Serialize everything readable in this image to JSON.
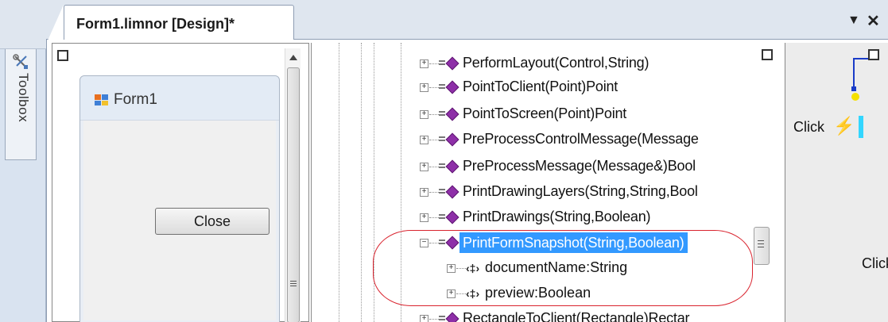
{
  "tab": {
    "title": "Form1.limnor [Design]*",
    "dropdown_icon": "▼",
    "close_icon": "✕"
  },
  "toolbox": {
    "label": "Toolbox"
  },
  "form_preview": {
    "title": "Form1",
    "close_button": "Close"
  },
  "tree": {
    "methods": [
      "PerformLayout(Control,String)",
      "PointToClient(Point)Point",
      "PointToScreen(Point)Point",
      "PreProcessControlMessage(Message",
      "PreProcessMessage(Message&)Bool",
      "PrintDrawingLayers(String,String,Bool",
      "PrintDrawings(String,Boolean)",
      "PrintFormSnapshot(String,Boolean)"
    ],
    "selected_index": 7,
    "parameters": [
      "documentName:String",
      "preview:Boolean"
    ],
    "next_method": "RectangleToClient(Rectangle)Rectar"
  },
  "right_panel": {
    "click_label_1": "Click",
    "click_label_2": "Click"
  },
  "colors": {
    "selection": "#3399ff",
    "method_icon": "#8e2fa8",
    "highlight_oval": "#d9232e"
  }
}
